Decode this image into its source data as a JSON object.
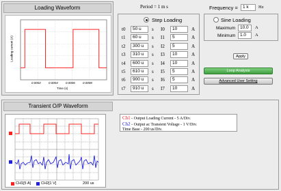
{
  "top": {
    "loading_waveform_title": "Loading Waveform",
    "period_label": "Period = 1 m s",
    "frequency_label": "Frequency =",
    "frequency_value": "1 k",
    "frequency_unit": "Hz"
  },
  "chart": {
    "ylabel": "Loading current (A)",
    "xlabel": "Time (s)",
    "xticks": [
      "0.0002",
      "0.0004",
      "0.0006",
      "0.0008"
    ]
  },
  "chart_data": {
    "type": "line",
    "xlabel": "Time (s)",
    "ylabel": "Loading current (A)",
    "xlim": [
      0,
      0.001
    ],
    "ylim": [
      0,
      500
    ],
    "x": [
      0,
      5e-05,
      5e-05,
      0.00029,
      0.00029,
      0.00061,
      0.00061,
      0.00091,
      0.00091,
      0.001
    ],
    "y": [
      100,
      100,
      420,
      420,
      100,
      100,
      420,
      420,
      100,
      100
    ],
    "color": "#ff2020"
  },
  "step": {
    "label": "Step Loading",
    "t_unit": "s",
    "i_unit": "A",
    "rows": [
      {
        "t_label": "t0",
        "t_value": "50 u",
        "i_label": "I0",
        "i_value": "10"
      },
      {
        "t_label": "t1",
        "t_value": "60 u",
        "i_label": "I1",
        "i_value": "5"
      },
      {
        "t_label": "t2",
        "t_value": "300 u",
        "i_label": "I2",
        "i_value": "5"
      },
      {
        "t_label": "t3",
        "t_value": "310 u",
        "i_label": "I3",
        "i_value": "10"
      },
      {
        "t_label": "t4",
        "t_value": "600 u",
        "i_label": "I4",
        "i_value": "10"
      },
      {
        "t_label": "t5",
        "t_value": "610 u",
        "i_label": "I5",
        "i_value": "5"
      },
      {
        "t_label": "t6",
        "t_value": "900 u",
        "i_label": "I6",
        "i_value": "5"
      },
      {
        "t_label": "t7",
        "t_value": "910 u",
        "i_label": "I7",
        "i_value": "10"
      }
    ]
  },
  "sine": {
    "label": "Sine Loading",
    "maximum_label": "Maximum",
    "maximum_value": "10.0",
    "minimum_label": "Minimum",
    "minimum_value": "1.0",
    "unit": "A",
    "apply_label": "Apply"
  },
  "buttons": {
    "loop_analysis": "Loop Analysis",
    "advanced_user_setting": "Advanced User Setting"
  },
  "transient": {
    "title": "Transient O/P Waveform",
    "ch1_legend": "CH1[5 A]",
    "ch2_legend": "CH2[1 V]",
    "time_base": "200 us",
    "ch1_color": "#ff2020",
    "ch2_color": "#2020e0",
    "info_ch1_tag": "Ch1",
    "info_ch1_text": " - Output Loading Current - 5 A/Div.",
    "info_ch2_tag": "Ch2",
    "info_ch2_text": " - Output ac Transient Voltage - 1 V/Div.",
    "info_time_base": "Time Base - 200 us/Div."
  }
}
